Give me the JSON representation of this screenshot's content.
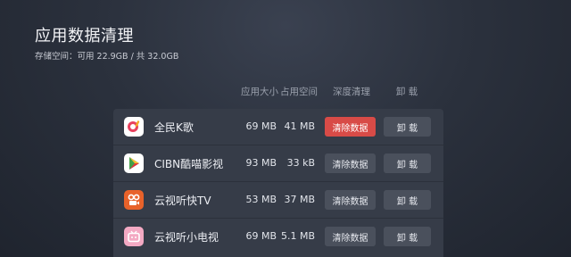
{
  "page": {
    "title": "应用数据清理",
    "storage": "存储空间：可用 22.9GB / 共 32.0GB"
  },
  "columns": {
    "size": "应用大小",
    "used": "占用空间",
    "clear": "深度清理",
    "uninstall": "卸 载"
  },
  "apps": [
    {
      "name": "全民K歌",
      "size": "69 MB",
      "used": "41 MB",
      "clear_label": "清除数据",
      "uninstall_label": "卸 载",
      "icon": "karaoke-icon",
      "icon_color": "#ffffff",
      "focused": true
    },
    {
      "name": "CIBN酷喵影视",
      "size": "93 MB",
      "used": "33 kB",
      "clear_label": "清除数据",
      "uninstall_label": "卸 载",
      "icon": "play-store-icon",
      "icon_color": "#ffffff",
      "focused": false
    },
    {
      "name": "云视听快TV",
      "size": "53 MB",
      "used": "37 MB",
      "clear_label": "清除数据",
      "uninstall_label": "卸 载",
      "icon": "video-app-icon",
      "icon_color": "#e8622a",
      "focused": false
    },
    {
      "name": "云视听小电视",
      "size": "69 MB",
      "used": "5.1 MB",
      "clear_label": "清除数据",
      "uninstall_label": "卸 载",
      "icon": "tv-app-icon",
      "icon_color": "#f3a9c3",
      "focused": false
    }
  ],
  "colors": {
    "accent": "#d84b47",
    "button": "#4a505c",
    "panel": "#363c48"
  }
}
